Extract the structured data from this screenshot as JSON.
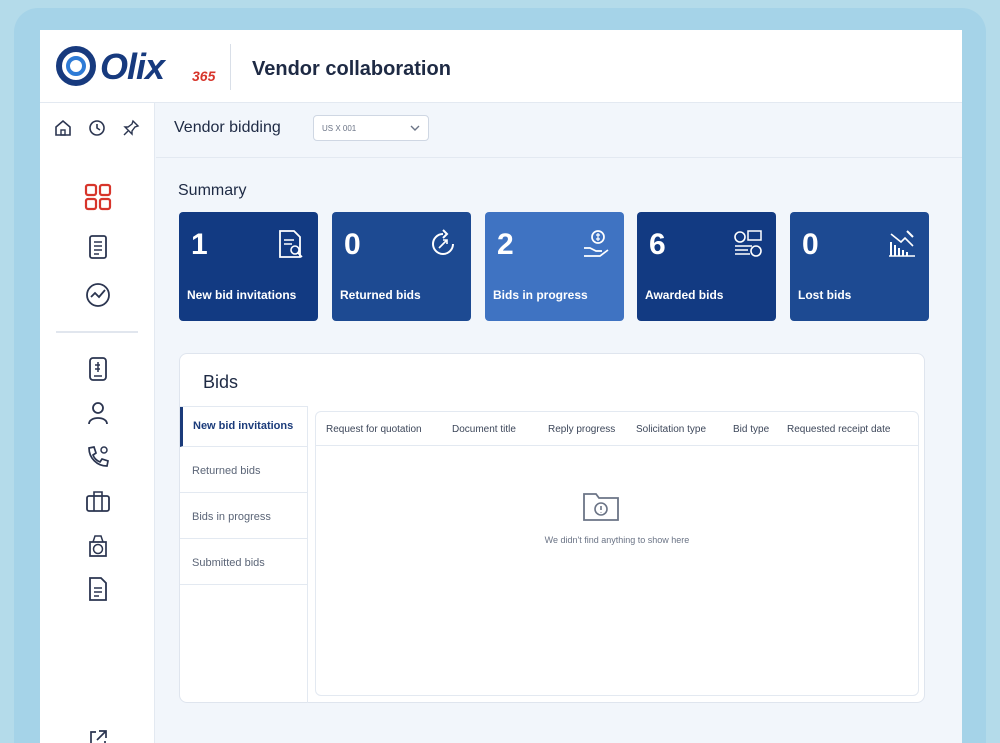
{
  "header": {
    "logo_text": "Olix",
    "logo_suffix": "365",
    "app_title": "Vendor collaboration"
  },
  "subheader": {
    "label": "Vendor bidding",
    "company_select": "US X 001"
  },
  "summary": {
    "title": "Summary",
    "cards": [
      {
        "value": "1",
        "label": "New bid invitations",
        "color": "#123a82"
      },
      {
        "value": "0",
        "label": "Returned bids",
        "color": "#1d4a92"
      },
      {
        "value": "2",
        "label": "Bids in progress",
        "color": "#3f73c2"
      },
      {
        "value": "6",
        "label": "Awarded bids",
        "color": "#123a82"
      },
      {
        "value": "0",
        "label": "Lost bids",
        "color": "#1d4a92"
      }
    ]
  },
  "bids": {
    "title": "Bids",
    "tabs": [
      "New bid invitations",
      "Returned bids",
      "Bids in progress",
      "Submitted bids"
    ],
    "columns": [
      "Request for quotation",
      "Document title",
      "Reply progress",
      "Solicitation type",
      "Bid type",
      "Requested receipt date"
    ],
    "empty_message": "We didn't find anything to show here"
  },
  "colors": {
    "accent": "#123a82",
    "brand_red": "#d7352b"
  }
}
